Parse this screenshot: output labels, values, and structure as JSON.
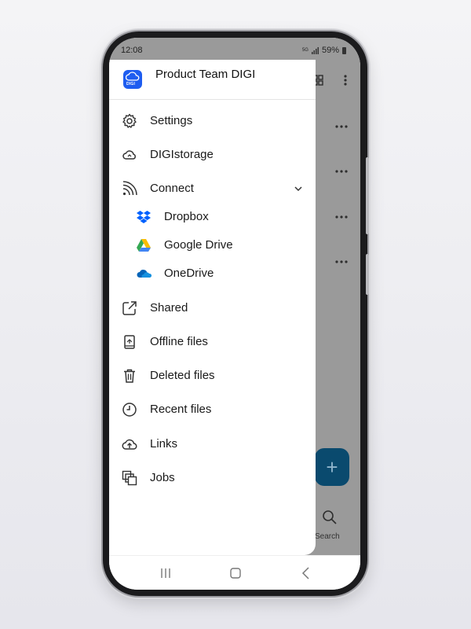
{
  "status_bar": {
    "time": "12:08",
    "network": "5G",
    "battery": "59%"
  },
  "drawer": {
    "workspace_name": "Product Team DIGI",
    "logo_text": "DIGI",
    "items": [
      {
        "label": "Settings",
        "icon": "gear-icon"
      },
      {
        "label": "DIGIstorage",
        "icon": "cloud-icon"
      },
      {
        "label": "Connect",
        "icon": "rss-icon"
      },
      {
        "label": "Shared",
        "icon": "share-icon"
      },
      {
        "label": "Offline files",
        "icon": "offline-file-icon"
      },
      {
        "label": "Deleted files",
        "icon": "trash-icon"
      },
      {
        "label": "Recent files",
        "icon": "clock-icon"
      },
      {
        "label": "Links",
        "icon": "cloud-upload-icon"
      },
      {
        "label": "Jobs",
        "icon": "jobs-icon"
      }
    ],
    "connect_subitems": [
      {
        "label": "Dropbox",
        "icon": "dropbox-icon"
      },
      {
        "label": "Google Drive",
        "icon": "google-drive-icon"
      },
      {
        "label": "OneDrive",
        "icon": "onedrive-icon"
      }
    ]
  },
  "background": {
    "search_label": "Search",
    "fab_label": "+"
  },
  "colors": {
    "accent": "#1e5df0",
    "fab": "#0a4a6e",
    "dropbox": "#0061fe",
    "onedrive": "#0364b8"
  }
}
